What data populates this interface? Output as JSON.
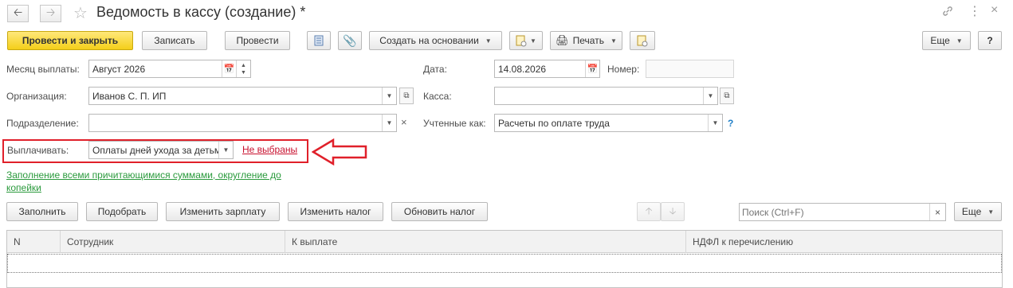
{
  "window": {
    "title": "Ведомость в кассу (создание) *",
    "back_icon": "arrow-left",
    "forward_icon": "arrow-right",
    "favorite_icon": "star",
    "link_icon": "link",
    "menu_icon": "more-vertical",
    "close_icon": "close"
  },
  "toolbar": {
    "post_close": "Провести и закрыть",
    "save": "Записать",
    "post": "Провести",
    "create_based": "Создать на основании",
    "print": "Печать",
    "more": "Еще",
    "help": "?"
  },
  "form": {
    "month_label": "Месяц выплаты:",
    "month_value": "Август 2026",
    "date_label": "Дата:",
    "date_value": "14.08.2026",
    "number_label": "Номер:",
    "number_value": "",
    "org_label": "Организация:",
    "org_value": "Иванов С. П. ИП",
    "cash_label": "Касса:",
    "cash_value": "",
    "dept_label": "Подразделение:",
    "dept_value": "",
    "accounted_label": "Учтенные как:",
    "accounted_value": "Расчеты по оплате труда",
    "accounted_help": "?",
    "pay_label": "Выплачивать:",
    "pay_value": "Оплаты дней ухода за детьми-инвалидами",
    "pay_link": "Не выбраны",
    "fill_hint": "Заполнение всеми причитающимися суммами, округление до копейки"
  },
  "table_toolbar": {
    "fill": "Заполнить",
    "pick": "Подобрать",
    "change_salary": "Изменить зарплату",
    "change_tax": "Изменить налог",
    "update_tax": "Обновить налог",
    "search_placeholder": "Поиск (Ctrl+F)",
    "more": "Еще"
  },
  "table": {
    "columns": [
      "N",
      "Сотрудник",
      "К выплате",
      "НДФЛ к перечислению"
    ],
    "rows": []
  },
  "colors": {
    "primary_button": "#f4cf1a",
    "highlight_frame": "#e0202a",
    "link_red": "#c8102e",
    "link_green": "#2a9a3c"
  }
}
